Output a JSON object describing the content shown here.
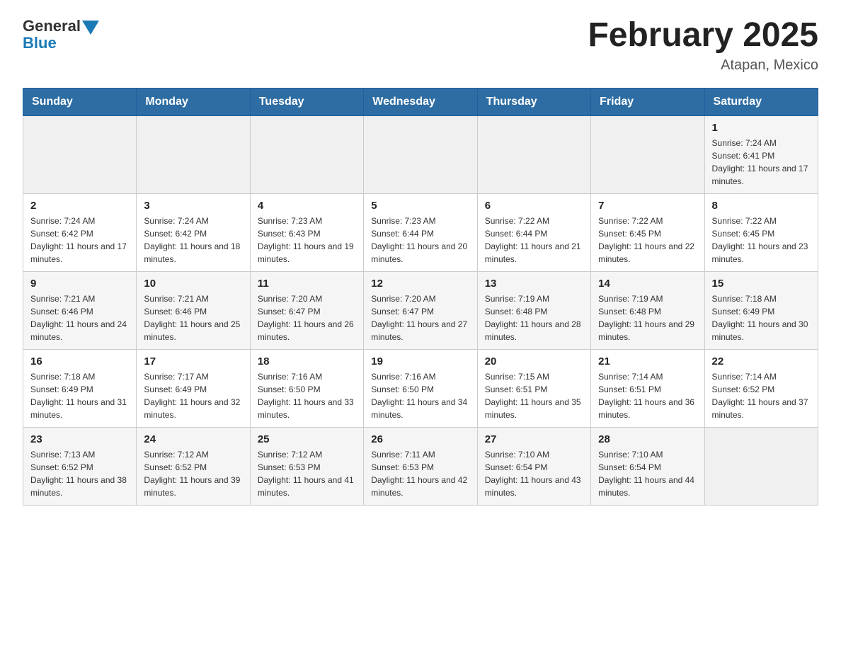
{
  "logo": {
    "general": "General",
    "blue": "Blue"
  },
  "header": {
    "title": "February 2025",
    "location": "Atapan, Mexico"
  },
  "weekdays": [
    "Sunday",
    "Monday",
    "Tuesday",
    "Wednesday",
    "Thursday",
    "Friday",
    "Saturday"
  ],
  "weeks": [
    [
      {
        "day": "",
        "info": ""
      },
      {
        "day": "",
        "info": ""
      },
      {
        "day": "",
        "info": ""
      },
      {
        "day": "",
        "info": ""
      },
      {
        "day": "",
        "info": ""
      },
      {
        "day": "",
        "info": ""
      },
      {
        "day": "1",
        "info": "Sunrise: 7:24 AM\nSunset: 6:41 PM\nDaylight: 11 hours and 17 minutes."
      }
    ],
    [
      {
        "day": "2",
        "info": "Sunrise: 7:24 AM\nSunset: 6:42 PM\nDaylight: 11 hours and 17 minutes."
      },
      {
        "day": "3",
        "info": "Sunrise: 7:24 AM\nSunset: 6:42 PM\nDaylight: 11 hours and 18 minutes."
      },
      {
        "day": "4",
        "info": "Sunrise: 7:23 AM\nSunset: 6:43 PM\nDaylight: 11 hours and 19 minutes."
      },
      {
        "day": "5",
        "info": "Sunrise: 7:23 AM\nSunset: 6:44 PM\nDaylight: 11 hours and 20 minutes."
      },
      {
        "day": "6",
        "info": "Sunrise: 7:22 AM\nSunset: 6:44 PM\nDaylight: 11 hours and 21 minutes."
      },
      {
        "day": "7",
        "info": "Sunrise: 7:22 AM\nSunset: 6:45 PM\nDaylight: 11 hours and 22 minutes."
      },
      {
        "day": "8",
        "info": "Sunrise: 7:22 AM\nSunset: 6:45 PM\nDaylight: 11 hours and 23 minutes."
      }
    ],
    [
      {
        "day": "9",
        "info": "Sunrise: 7:21 AM\nSunset: 6:46 PM\nDaylight: 11 hours and 24 minutes."
      },
      {
        "day": "10",
        "info": "Sunrise: 7:21 AM\nSunset: 6:46 PM\nDaylight: 11 hours and 25 minutes."
      },
      {
        "day": "11",
        "info": "Sunrise: 7:20 AM\nSunset: 6:47 PM\nDaylight: 11 hours and 26 minutes."
      },
      {
        "day": "12",
        "info": "Sunrise: 7:20 AM\nSunset: 6:47 PM\nDaylight: 11 hours and 27 minutes."
      },
      {
        "day": "13",
        "info": "Sunrise: 7:19 AM\nSunset: 6:48 PM\nDaylight: 11 hours and 28 minutes."
      },
      {
        "day": "14",
        "info": "Sunrise: 7:19 AM\nSunset: 6:48 PM\nDaylight: 11 hours and 29 minutes."
      },
      {
        "day": "15",
        "info": "Sunrise: 7:18 AM\nSunset: 6:49 PM\nDaylight: 11 hours and 30 minutes."
      }
    ],
    [
      {
        "day": "16",
        "info": "Sunrise: 7:18 AM\nSunset: 6:49 PM\nDaylight: 11 hours and 31 minutes."
      },
      {
        "day": "17",
        "info": "Sunrise: 7:17 AM\nSunset: 6:49 PM\nDaylight: 11 hours and 32 minutes."
      },
      {
        "day": "18",
        "info": "Sunrise: 7:16 AM\nSunset: 6:50 PM\nDaylight: 11 hours and 33 minutes."
      },
      {
        "day": "19",
        "info": "Sunrise: 7:16 AM\nSunset: 6:50 PM\nDaylight: 11 hours and 34 minutes."
      },
      {
        "day": "20",
        "info": "Sunrise: 7:15 AM\nSunset: 6:51 PM\nDaylight: 11 hours and 35 minutes."
      },
      {
        "day": "21",
        "info": "Sunrise: 7:14 AM\nSunset: 6:51 PM\nDaylight: 11 hours and 36 minutes."
      },
      {
        "day": "22",
        "info": "Sunrise: 7:14 AM\nSunset: 6:52 PM\nDaylight: 11 hours and 37 minutes."
      }
    ],
    [
      {
        "day": "23",
        "info": "Sunrise: 7:13 AM\nSunset: 6:52 PM\nDaylight: 11 hours and 38 minutes."
      },
      {
        "day": "24",
        "info": "Sunrise: 7:12 AM\nSunset: 6:52 PM\nDaylight: 11 hours and 39 minutes."
      },
      {
        "day": "25",
        "info": "Sunrise: 7:12 AM\nSunset: 6:53 PM\nDaylight: 11 hours and 41 minutes."
      },
      {
        "day": "26",
        "info": "Sunrise: 7:11 AM\nSunset: 6:53 PM\nDaylight: 11 hours and 42 minutes."
      },
      {
        "day": "27",
        "info": "Sunrise: 7:10 AM\nSunset: 6:54 PM\nDaylight: 11 hours and 43 minutes."
      },
      {
        "day": "28",
        "info": "Sunrise: 7:10 AM\nSunset: 6:54 PM\nDaylight: 11 hours and 44 minutes."
      },
      {
        "day": "",
        "info": ""
      }
    ]
  ]
}
